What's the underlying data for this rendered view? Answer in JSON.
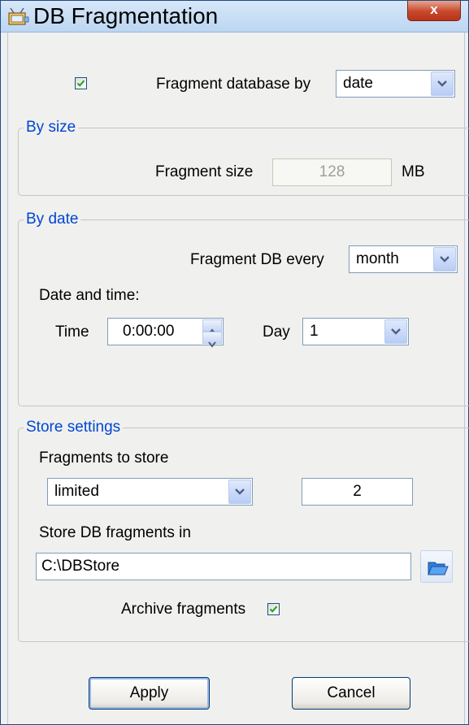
{
  "window": {
    "title": "DB Fragmentation",
    "close_label": "x",
    "icons": {
      "title": "monitor-icon",
      "close": "close-icon"
    },
    "colors": {
      "titlebar": "#bcd6f2",
      "close": "#c8482c",
      "legend": "#0046d5"
    }
  },
  "fragment_by": {
    "checked": true,
    "label": "Fragment database by",
    "value": "date"
  },
  "by_size": {
    "legend": "By size",
    "size_label": "Fragment size",
    "size_value": "128",
    "unit": "MB"
  },
  "by_date": {
    "legend": "By date",
    "every_label": "Fragment DB every",
    "every_value": "month",
    "datetime_label": "Date and time:",
    "time_label": "Time",
    "time_value": "0:00:00",
    "day_label": "Day",
    "day_value": "1"
  },
  "store": {
    "legend": "Store settings",
    "fragments_label": "Fragments to store",
    "fragments_mode": "limited",
    "fragments_count": "2",
    "path_label": "Store DB fragments in",
    "path_value": "C:\\DBStore",
    "browse_icon": "open-folder-icon",
    "archive_label": "Archive fragments",
    "archive_checked": true
  },
  "buttons": {
    "apply": "Apply",
    "cancel": "Cancel"
  }
}
